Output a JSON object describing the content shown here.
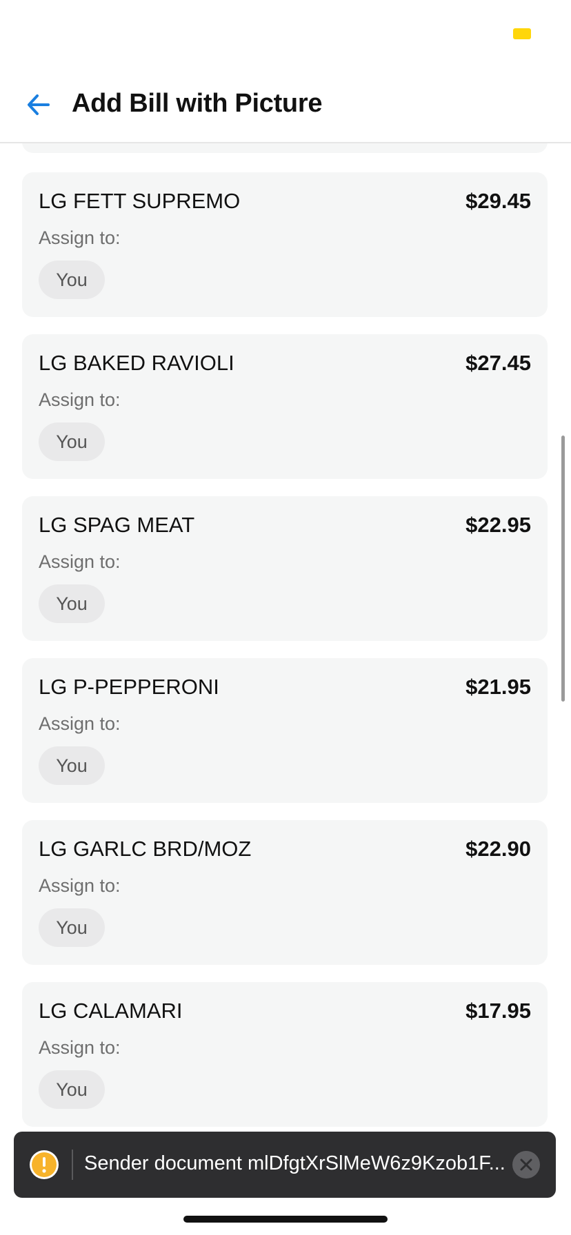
{
  "header": {
    "title": "Add Bill with Picture",
    "back_icon": "arrow-left-icon",
    "accent_color": "#1a7fe0"
  },
  "status_bar": {
    "indicator_color": "#ffd60a"
  },
  "items": [
    {
      "name": "LG FETT SUPREMO",
      "price": "$29.45",
      "assign_label": "Assign to:",
      "assignee": "You"
    },
    {
      "name": "LG BAKED RAVIOLI",
      "price": "$27.45",
      "assign_label": "Assign to:",
      "assignee": "You"
    },
    {
      "name": "LG SPAG MEAT",
      "price": "$22.95",
      "assign_label": "Assign to:",
      "assignee": "You"
    },
    {
      "name": "LG P-PEPPERONI",
      "price": "$21.95",
      "assign_label": "Assign to:",
      "assignee": "You"
    },
    {
      "name": "LG GARLC BRD/MOZ",
      "price": "$22.90",
      "assign_label": "Assign to:",
      "assignee": "You"
    },
    {
      "name": "LG CALAMARI",
      "price": "$17.95",
      "assign_label": "Assign to:",
      "assignee": "You"
    }
  ],
  "toast": {
    "text": "Sender document mlDfgtXrSlMeW6z9Kzob1F...",
    "warning_icon": "warning-icon",
    "close_icon": "close-icon",
    "warning_color": "#f7b32b"
  }
}
